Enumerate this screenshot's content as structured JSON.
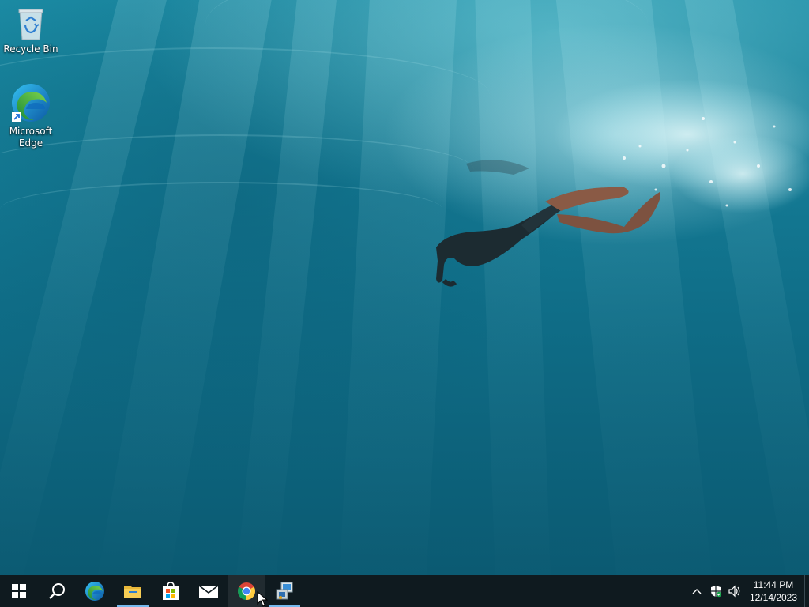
{
  "desktop": {
    "icons": [
      {
        "label": "Recycle Bin",
        "icon": "recycle-bin-icon"
      },
      {
        "label": "Microsoft Edge",
        "icon": "edge-icon"
      }
    ]
  },
  "taskbar": {
    "buttons": [
      {
        "name": "start",
        "icon": "windows-logo-icon"
      },
      {
        "name": "search",
        "icon": "search-icon"
      },
      {
        "name": "edge",
        "icon": "edge-icon"
      },
      {
        "name": "file-explorer",
        "icon": "folder-icon"
      },
      {
        "name": "microsoft-store",
        "icon": "store-bag-icon"
      },
      {
        "name": "mail",
        "icon": "mail-icon"
      },
      {
        "name": "chrome",
        "icon": "chrome-icon"
      },
      {
        "name": "app",
        "icon": "installer-icon"
      }
    ],
    "tray": {
      "icons": [
        "chevron-up-icon",
        "security-shield-icon",
        "speaker-icon"
      ],
      "time": "11:44 PM",
      "date": "12/14/2023"
    }
  },
  "colors": {
    "taskbar": "#0f1a1f",
    "accent": "#76b9ed"
  }
}
